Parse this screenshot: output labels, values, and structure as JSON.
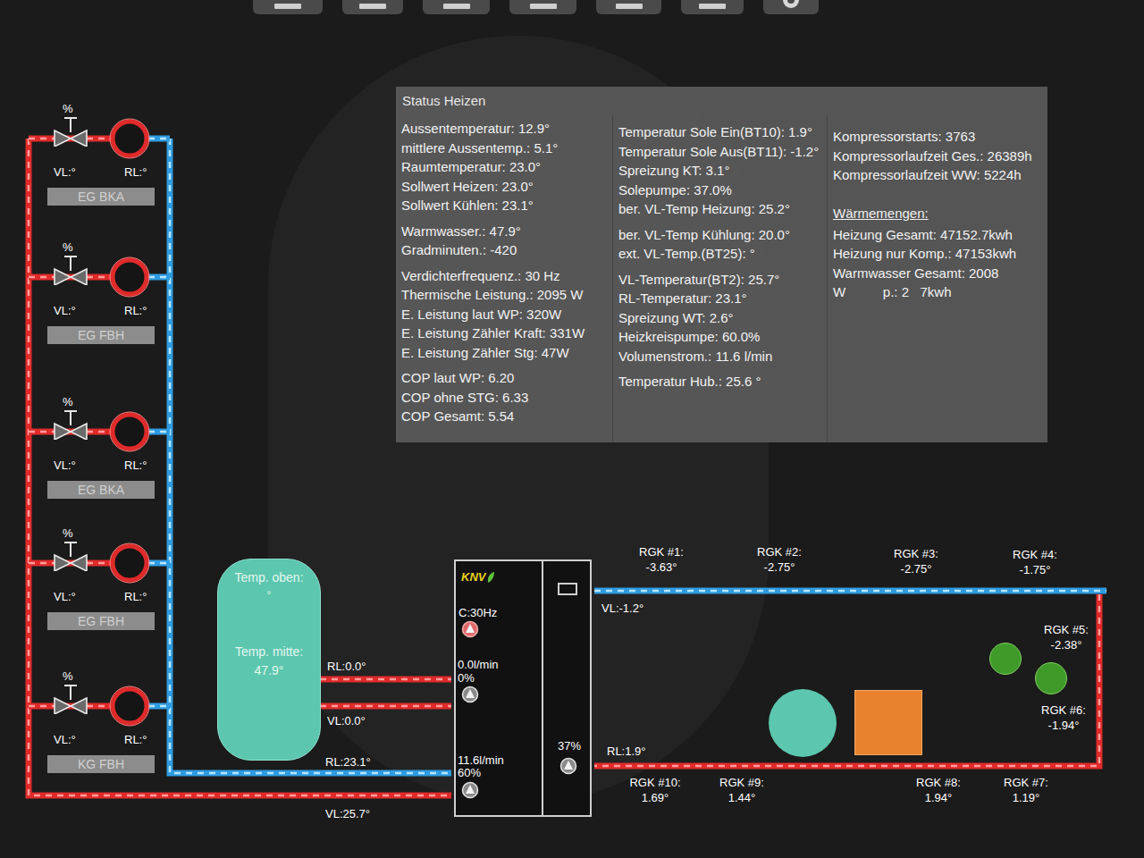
{
  "status": {
    "title": "Status Heizen",
    "columns": [
      {
        "groups": [
          {
            "heading": "",
            "lines": [
              "Aussentemperatur: 12.9°",
              "mittlere Aussentemp.: 5.1°",
              "Raumtemperatur: 23.0°",
              "Sollwert Heizen: 23.0°",
              "Sollwert Kühlen: 23.1°"
            ]
          },
          {
            "heading": "",
            "lines": [
              "Warmwasser.: 47.9°",
              "Gradminuten.: -420"
            ]
          },
          {
            "heading": "",
            "lines": [
              "Verdichterfrequenz.: 30 Hz",
              "Thermische Leistung.: 2095 W",
              "E. Leistung laut WP: 320W",
              "E. Leistung Zähler Kraft: 331W",
              "E. Leistung Zähler Stg: 47W"
            ]
          },
          {
            "heading": "",
            "lines": [
              "COP laut WP: 6.20",
              "COP ohne STG: 6.33",
              "COP Gesamt: 5.54"
            ]
          }
        ]
      },
      {
        "groups": [
          {
            "heading": "",
            "lines": [
              "Temperatur Sole Ein(BT10): 1.9°",
              "Temperatur Sole Aus(BT11): -1.2°",
              "Spreizung KT: 3.1°",
              "Solepumpe: 37.0%",
              "ber. VL-Temp Heizung: 25.2°"
            ]
          },
          {
            "heading": "",
            "lines": [
              "ber. VL-Temp Kühlung: 20.0°",
              "ext. VL-Temp.(BT25): °"
            ]
          },
          {
            "heading": "",
            "lines": [
              "VL-Temperatur(BT2): 25.7°",
              "RL-Temperatur: 23.1°",
              "Spreizung WT: 2.6°",
              "Heizkreispumpe: 60.0%",
              "Volumenstrom.: 11.6 l/min"
            ]
          },
          {
            "heading": "",
            "lines": [
              "Temperatur Hub.: 25.6 °"
            ]
          }
        ]
      },
      {
        "groups": [
          {
            "heading": "",
            "lines": [
              "Kompressorstarts: 3763",
              "Kompressorlaufzeit Ges.: 26389h",
              "Kompressorlaufzeit WW: 5224h"
            ]
          },
          {
            "heading": "Wärmemengen:",
            "lines": [
              "Heizung Gesamt: 47152.7kwh",
              "Heizung nur Komp.: 47153kwh",
              "Warmwasser Gesamt: 2008",
              "W          p.: 2   7kwh"
            ]
          }
        ]
      }
    ]
  },
  "circuits": [
    {
      "percent": "%",
      "vl": "VL:°",
      "rl": "RL:°",
      "name": "EG BKA"
    },
    {
      "percent": "%",
      "vl": "VL:°",
      "rl": "RL:°",
      "name": "EG FBH"
    },
    {
      "percent": "%",
      "vl": "VL:°",
      "rl": "RL:°",
      "name": "EG BKA"
    },
    {
      "percent": "%",
      "vl": "VL:°",
      "rl": "RL:°",
      "name": "EG FBH"
    },
    {
      "percent": "%",
      "vl": "VL:°",
      "rl": "RL:°",
      "name": "KG FBH"
    }
  ],
  "tank": {
    "top_label": "Temp. oben:",
    "top_value": "°",
    "mid_label": "Temp. mitte:",
    "mid_value": "47.9°"
  },
  "buffer_lines": {
    "tank_rl": "RL:0.0°",
    "tank_vl": "VL:0.0°",
    "rl": "RL:23.1°",
    "vl": "VL:25.7°"
  },
  "heat_pump": {
    "logo": "KNV",
    "compressor": "C:30Hz",
    "pump_ww": {
      "flow": "0.0l/min",
      "percent": "0%"
    },
    "pump_heating": {
      "flow": "11.6l/min",
      "percent": "60%"
    },
    "brine_pump": "37%"
  },
  "brine": {
    "vl": "VL:-1.2°",
    "rl": "RL:1.9°",
    "probes": [
      {
        "name": "RGK #1:",
        "value": "-3.63°"
      },
      {
        "name": "RGK #2:",
        "value": "-2.75°"
      },
      {
        "name": "RGK #3:",
        "value": "-2.75°"
      },
      {
        "name": "RGK #4:",
        "value": "-1.75°"
      },
      {
        "name": "RGK #5:",
        "value": "-2.38°"
      },
      {
        "name": "RGK #6:",
        "value": "-1.94°"
      },
      {
        "name": "RGK #7:",
        "value": "1.19°"
      },
      {
        "name": "RGK #8:",
        "value": "1.94°"
      },
      {
        "name": "RGK #9:",
        "value": "1.44°"
      },
      {
        "name": "RGK #10:",
        "value": "1.69°"
      }
    ]
  }
}
